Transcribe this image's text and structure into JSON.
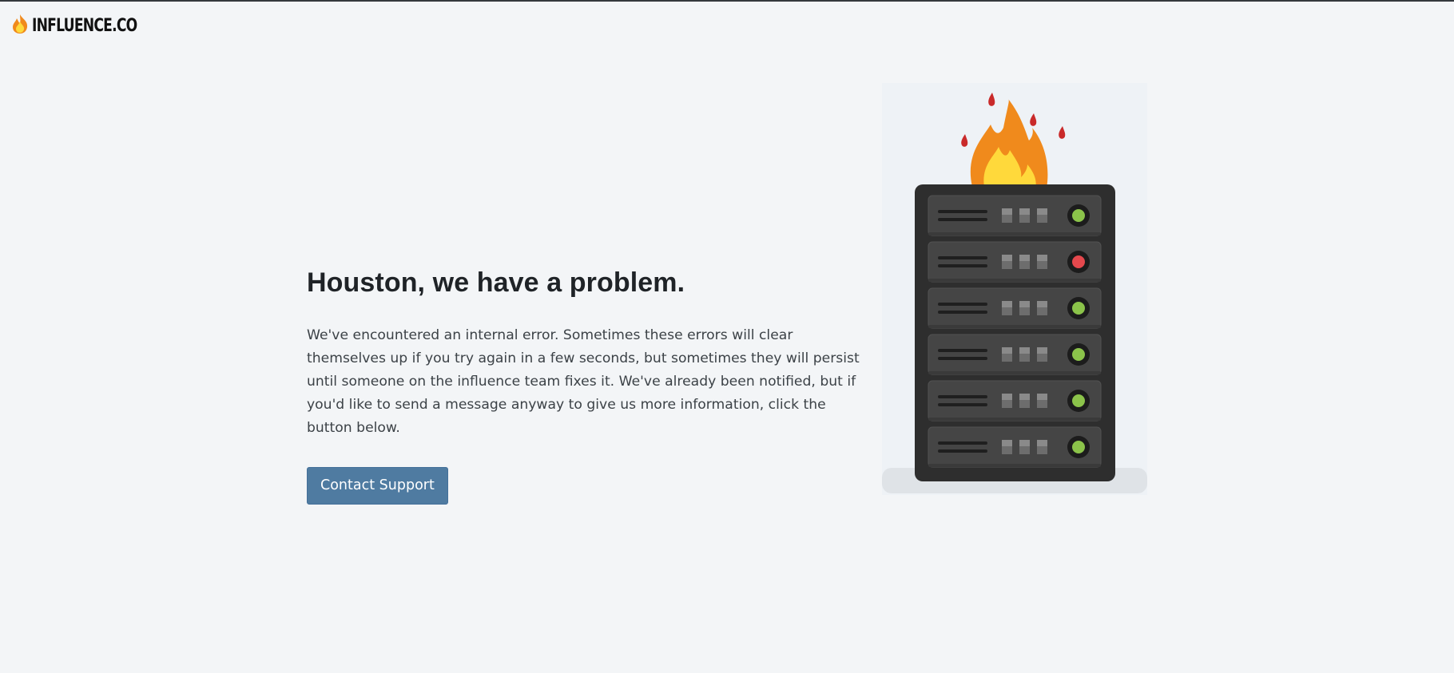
{
  "header": {
    "logo_icon": "fire-icon",
    "logo_text": "INFLUENCE.CO"
  },
  "main": {
    "headline": "Houston, we have a problem.",
    "message": "We've encountered an internal error. Sometimes these errors will clear themselves up if you try again in a few seconds, but sometimes they will persist until someone on the influence team fixes it. We've already been notified, but if you'd like to send a message anyway to give us more information, click the button below.",
    "contact_button_label": "Contact Support"
  },
  "illustration": {
    "icon": "server-on-fire-icon",
    "status_lights": [
      "green",
      "red",
      "green",
      "green",
      "green",
      "green"
    ]
  },
  "colors": {
    "background": "#f3f5f7",
    "button": "#4f7ba1",
    "server": "#2e2e2e",
    "light_green": "#8bc34a",
    "light_red": "#e5484d",
    "flame_outer": "#f08a1c",
    "flame_inner": "#ffd93b"
  }
}
